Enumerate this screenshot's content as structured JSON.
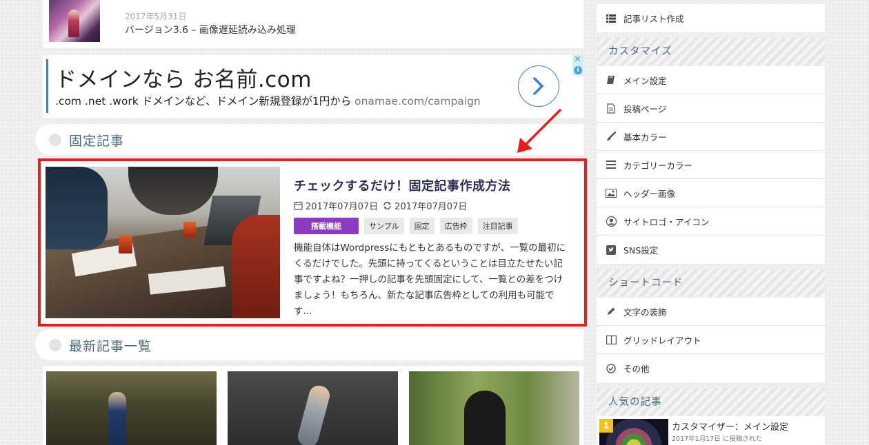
{
  "recent": {
    "date": "2017年5月31日",
    "title": "バージョン3.6 – 画像遅延読み込み処理"
  },
  "ad": {
    "title": "ドメインなら お名前.com",
    "desc": ".com .net .work ドメインなど、ドメイン新規登録が1円から",
    "domain": "onamae.com/campaign",
    "close": "✕",
    "info": "i"
  },
  "sections": {
    "fixed": "固定記事",
    "latest": "最新記事一覧"
  },
  "featured": {
    "title": "チェックするだけ！固定記事作成方法",
    "published": "2017年07月07日",
    "updated": "2017年07月07日",
    "tags": [
      "搭載機能",
      "サンプル",
      "固定",
      "広告枠",
      "注目記事"
    ],
    "excerpt": "機能自体はWordpressにもともとあるものですが、一覧の最初にくるだけでした。先頭に持ってくるということは目立たせたい記事ですよね？一押しの記事を先頭固定にして、一覧との差をつけましょう！もちろん、新たな記事広告枠としての利用も可能です..."
  },
  "sidebar": {
    "top_item": {
      "label": "記事リスト作成",
      "icon": "list-icon"
    },
    "customize": {
      "heading": "カスタマイズ",
      "items": [
        {
          "label": "メイン設定",
          "icon": "book-icon"
        },
        {
          "label": "投稿ページ",
          "icon": "document-icon"
        },
        {
          "label": "基本カラー",
          "icon": "brush-icon"
        },
        {
          "label": "カテゴリーカラー",
          "icon": "menu-icon"
        },
        {
          "label": "ヘッダー画像",
          "icon": "image-icon"
        },
        {
          "label": "サイトロゴ・アイコン",
          "icon": "user-circle-icon"
        },
        {
          "label": "SNS設定",
          "icon": "twitter-icon"
        }
      ]
    },
    "shortcode": {
      "heading": "ショートコード",
      "items": [
        {
          "label": "文字の装飾",
          "icon": "pencil-icon"
        },
        {
          "label": "グリッドレイアウト",
          "icon": "columns-icon"
        },
        {
          "label": "その他",
          "icon": "check-circle-icon"
        }
      ]
    },
    "popular": {
      "heading": "人気の記事",
      "rank": "1",
      "title": "カスタマイザー：メイン設定",
      "meta": "2017年1月17日 に投稿された"
    }
  }
}
